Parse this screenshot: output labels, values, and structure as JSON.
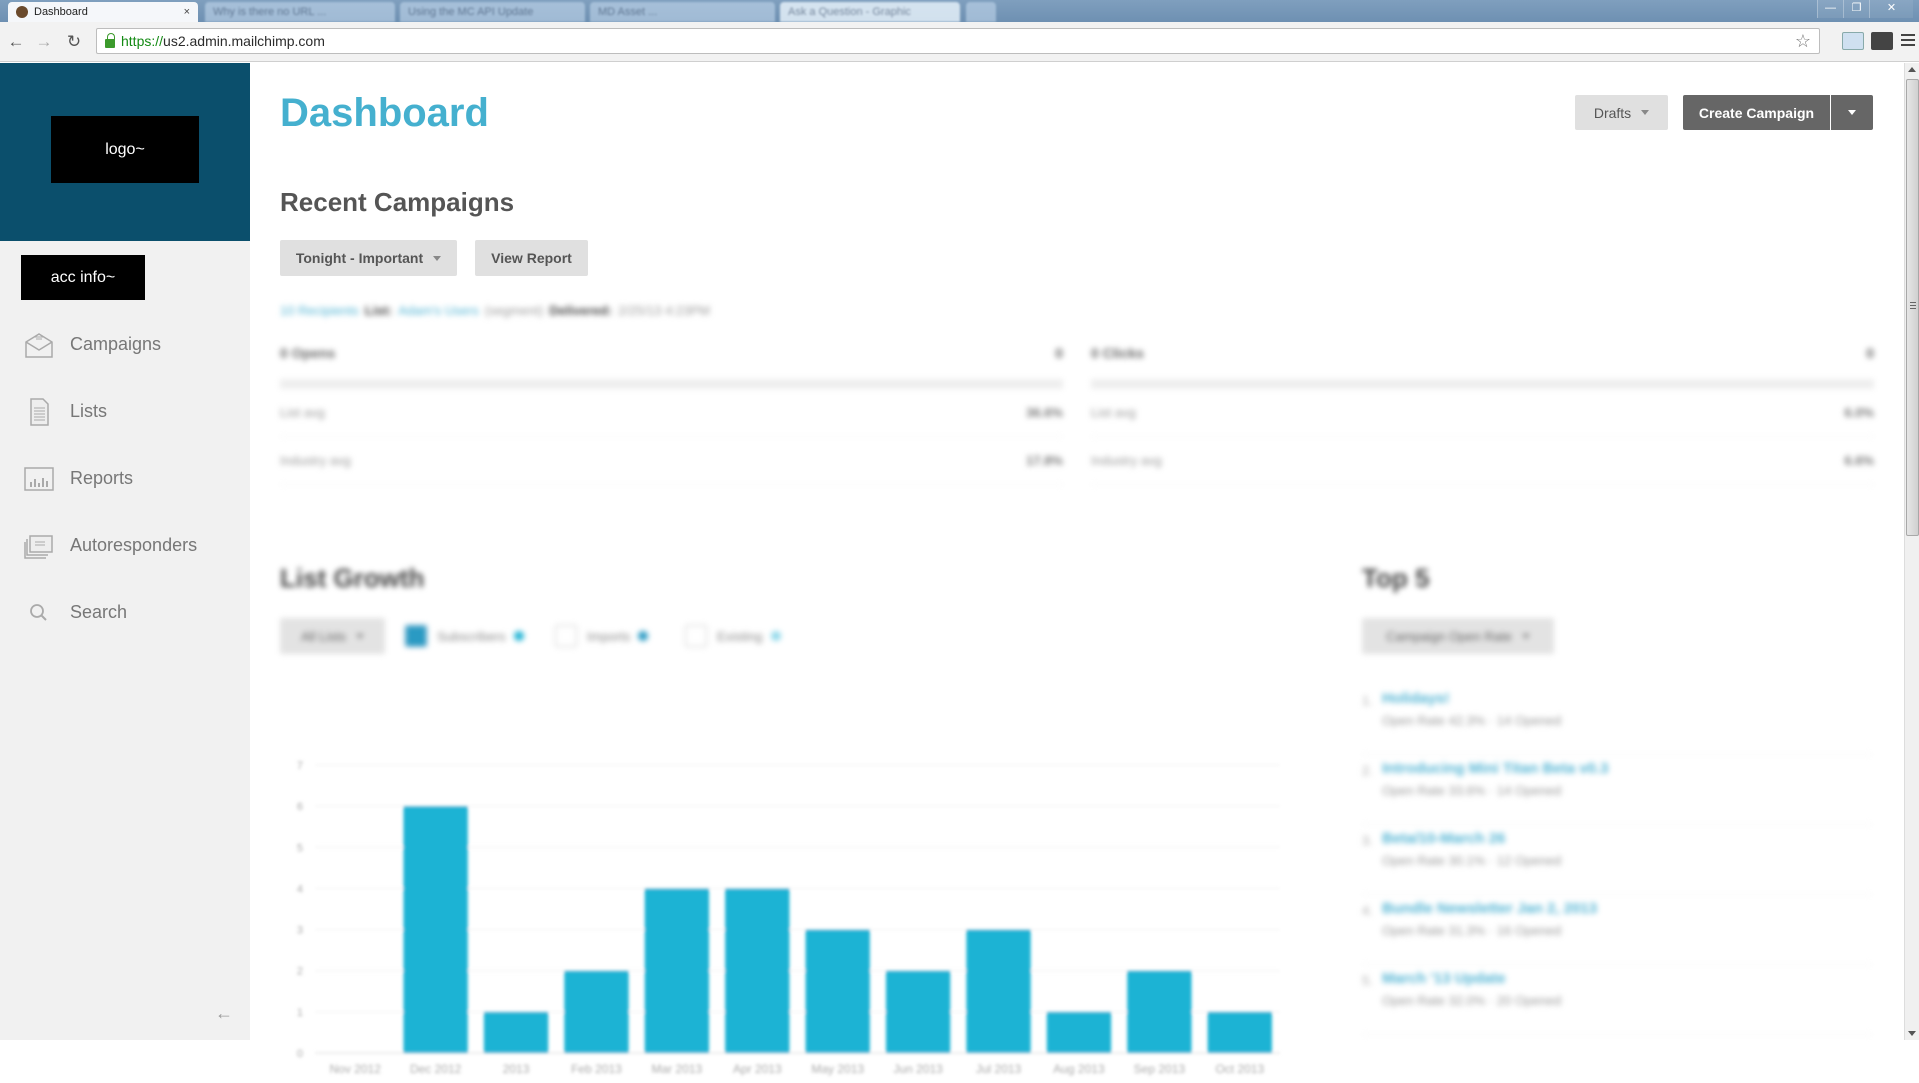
{
  "browser": {
    "tabs": [
      {
        "label": "Dashboard",
        "active": true
      },
      {
        "label": "Why is there no URL ...",
        "active": false
      },
      {
        "label": "Using the MC API Update",
        "active": false
      },
      {
        "label": "MD Asset ...",
        "active": false
      },
      {
        "label": "Ask a Question - Graphic",
        "active": false
      }
    ],
    "url_scheme": "https://",
    "url_host": "us2.admin.mailchimp.com",
    "window_controls": {
      "minimize": "—",
      "restore": "❐",
      "close": "✕"
    }
  },
  "sidebar": {
    "logo_text": "logo~",
    "account_text": "acc info~",
    "items": [
      {
        "label": "Campaigns",
        "icon": "envelope-icon"
      },
      {
        "label": "Lists",
        "icon": "document-icon"
      },
      {
        "label": "Reports",
        "icon": "bar-chart-icon"
      },
      {
        "label": "Autoresponders",
        "icon": "stacked-mail-icon"
      },
      {
        "label": "Search",
        "icon": "search-icon"
      }
    ],
    "collapse_glyph": "←"
  },
  "header": {
    "title": "Dashboard",
    "drafts_label": "Drafts",
    "create_campaign_label": "Create Campaign"
  },
  "recent_campaigns": {
    "title": "Recent Campaigns",
    "selected_campaign": "Tonight - Important",
    "view_report_label": "View Report",
    "meta": {
      "recipients": "10 Recipients",
      "list_label": "List:",
      "list_name": "Adam's Users",
      "segment": "(segment)",
      "delivered_label": "Delivered:",
      "delivered_value": "2/25/13 4:23PM"
    },
    "opens": {
      "label": "0 Opens",
      "value": "0",
      "list_avg_label": "List avg",
      "list_avg": "36.6%",
      "industry_avg_label": "Industry avg",
      "industry_avg": "17.8%"
    },
    "clicks": {
      "label": "0 Clicks",
      "value": "0",
      "list_avg_label": "List avg",
      "list_avg": "6.0%",
      "industry_avg_label": "Industry avg",
      "industry_avg": "6.6%"
    }
  },
  "list_growth": {
    "title": "List Growth",
    "list_select": "All Lists",
    "legend": [
      {
        "label": "Subscribers",
        "checked": true,
        "color": "#1fb3d4"
      },
      {
        "label": "Imports",
        "checked": false,
        "color": "#2a9ac3"
      },
      {
        "label": "Existing",
        "checked": false,
        "color": "#8fd8ea"
      }
    ]
  },
  "chart_data": {
    "type": "bar",
    "title": "List Growth",
    "xlabel": "",
    "ylabel": "",
    "categories": [
      "Nov 2012",
      "Dec 2012",
      "2013",
      "Feb 2013",
      "Mar 2013",
      "Apr 2013",
      "May 2013",
      "Jun 2013",
      "Jul 2013",
      "Aug 2013",
      "Sep 2013",
      "Oct 2013"
    ],
    "series": [
      {
        "name": "Subscribers",
        "values": [
          0,
          6,
          1,
          2,
          4,
          4,
          3,
          2,
          3,
          1,
          2,
          1
        ],
        "color": "#1fb3d4"
      }
    ],
    "ylim": [
      0,
      7
    ],
    "yticks": [
      0,
      1,
      2,
      3,
      4,
      5,
      6,
      7
    ],
    "grid": true,
    "legend": "top-left"
  },
  "top5": {
    "title": "Top 5",
    "select": "Campaign Open Rate",
    "items": [
      {
        "rank": "1.",
        "title": "Holidays!",
        "sub": "Open Rate 42.3%  ·  14 Opened"
      },
      {
        "rank": "2.",
        "title": "Introducing Mini Titan Beta v0.3",
        "sub": "Open Rate 33.6%  ·  14 Opened"
      },
      {
        "rank": "3.",
        "title": "Beta/10-March 26",
        "sub": "Open Rate 30.1%  ·  12 Opened"
      },
      {
        "rank": "4.",
        "title": "Bundle Newsletter Jan 2, 2013",
        "sub": "Open Rate 31.3%  ·  16 Opened"
      },
      {
        "rank": "5.",
        "title": "March '13 Update",
        "sub": "Open Rate 32.0%  ·  20 Opened"
      }
    ]
  }
}
